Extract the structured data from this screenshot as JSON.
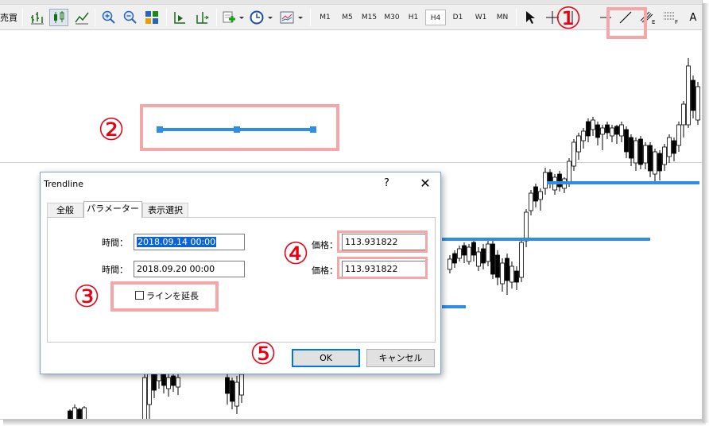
{
  "toolbar": {
    "menu_fragment": "売買",
    "timeframes": [
      "M1",
      "M5",
      "M15",
      "M30",
      "H1",
      "H4",
      "D1",
      "W1",
      "MN"
    ],
    "active_timeframe": "H4",
    "text_tool": "A"
  },
  "dialog": {
    "title": "Trendline",
    "help_label": "?",
    "close_label": "✕",
    "tabs": [
      "全般",
      "パラメーター",
      "表示選択"
    ],
    "active_tab": "パラメーター",
    "time1_label": "時間：",
    "time1_value": "2018.09.14 00:00",
    "time2_label": "時間：",
    "time2_value": "2018.09.20 00:00",
    "price1_label": "価格：",
    "price1_value": "113.931822",
    "price2_label": "価格：",
    "price2_value": "113.931822",
    "extend_label": "ラインを延長",
    "extend_checked": false,
    "ok_label": "OK",
    "cancel_label": "キャンセル"
  },
  "annotations": {
    "n1": "①",
    "n2": "②",
    "n3": "③",
    "n4": "④",
    "n5": "⑤"
  },
  "colors": {
    "annotation_box": "#f5a7a7",
    "annotation_number": "#e60012",
    "trendline": "#2e8ee6",
    "candles": "#000000"
  }
}
